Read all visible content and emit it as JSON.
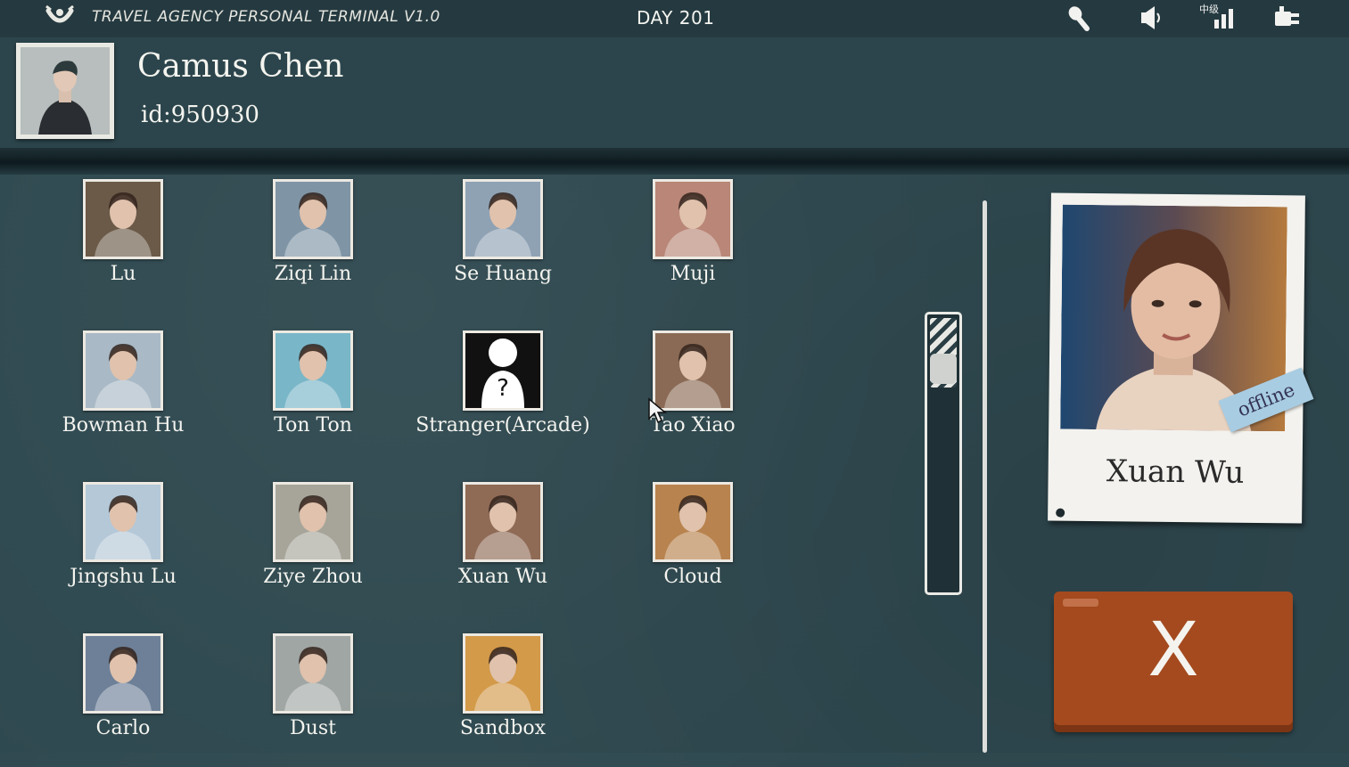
{
  "header": {
    "terminal_title": "TRAVEL AGENCY PERSONAL TERMINAL V1.0",
    "day_label": "DAY 201",
    "signal_label": "中级",
    "icons": [
      "logo-icon",
      "microphone-icon",
      "speaker-icon",
      "signal-icon",
      "plug-icon"
    ]
  },
  "profile": {
    "name": "Camus Chen",
    "id_label": "id:950930"
  },
  "contacts": [
    {
      "name": "Lu",
      "color": "#6b5a48"
    },
    {
      "name": "Ziqi Lin",
      "color": "#7f95a6"
    },
    {
      "name": "Se Huang",
      "color": "#8fa2b4"
    },
    {
      "name": "Muji",
      "color": "#b98677"
    },
    {
      "name": "Bowman Hu",
      "color": "#a9b9c6"
    },
    {
      "name": "Ton Ton",
      "color": "#79b6c8"
    },
    {
      "name": "Stranger(Arcade)",
      "color": "#101010"
    },
    {
      "name": "Tao Xiao",
      "color": "#8a6a55"
    },
    {
      "name": "Jingshu Lu",
      "color": "#b4c8d8"
    },
    {
      "name": "Ziye Zhou",
      "color": "#a7a59a"
    },
    {
      "name": "Xuan Wu",
      "color": "#8f6a55"
    },
    {
      "name": "Cloud",
      "color": "#b8834e"
    },
    {
      "name": "Carlo",
      "color": "#6d8098"
    },
    {
      "name": "Dust",
      "color": "#a0a6a4"
    },
    {
      "name": "Sandbox",
      "color": "#d39a4a"
    }
  ],
  "selected": {
    "name": "Xuan Wu",
    "status": "offline"
  },
  "scrollbar": {
    "position": 0.0
  },
  "close_label": "X"
}
